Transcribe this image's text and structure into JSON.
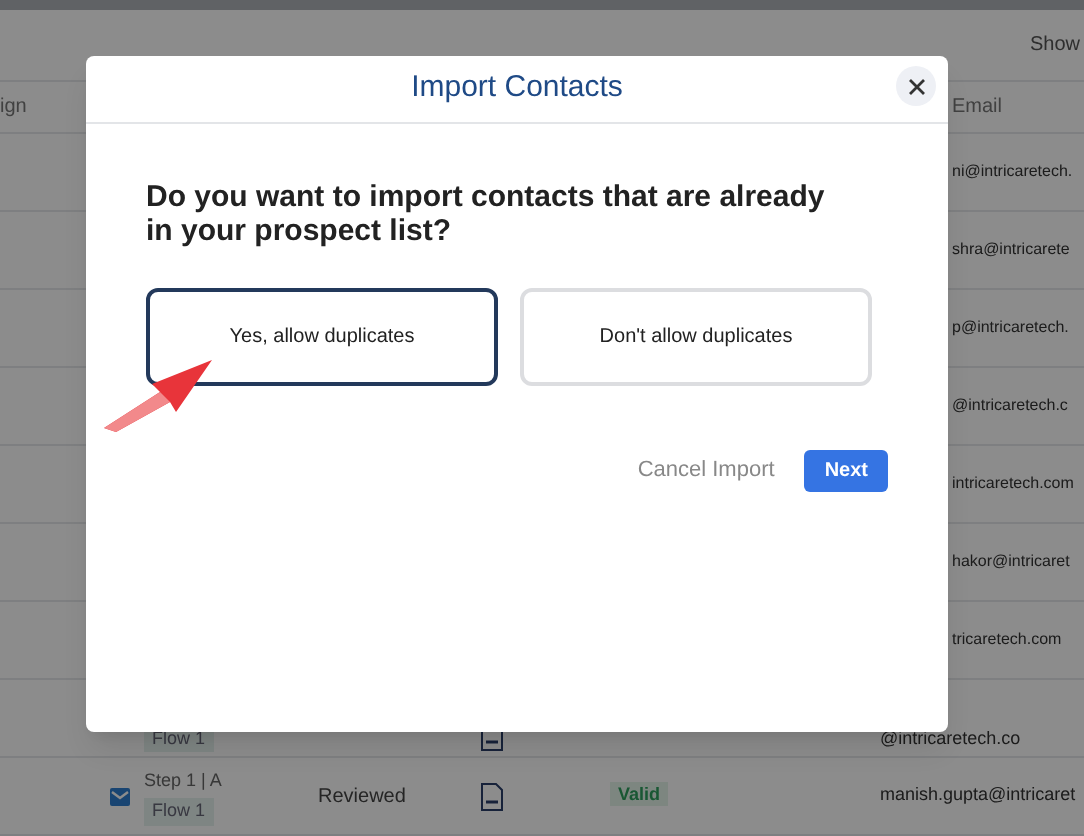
{
  "background": {
    "toolbar": {
      "show_label": "Show"
    },
    "columns": [
      "ign",
      "Email"
    ],
    "rows": [
      {
        "email": "ni@intricaretech."
      },
      {
        "email": "shra@intricarete"
      },
      {
        "email": "p@intricaretech."
      },
      {
        "email": "@intricaretech.c"
      },
      {
        "email": "intricaretech.com"
      },
      {
        "email": "hakor@intricaret"
      },
      {
        "email": "tricaretech.com"
      },
      {
        "flow": "Flow 1",
        "email": "@intricaretech.co"
      },
      {
        "step": "Step 1 | A",
        "flow": "Flow 1",
        "status": "Reviewed",
        "validity": "Valid",
        "email": "manish.gupta@intricaret"
      }
    ]
  },
  "modal": {
    "title": "Import Contacts",
    "question": "Do you want to import contacts that are already in your prospect list?",
    "options": [
      {
        "label": "Yes, allow duplicates",
        "selected": true
      },
      {
        "label": "Don't allow duplicates",
        "selected": false
      }
    ],
    "buttons": [
      {
        "label": "Cancel Import",
        "kind": "text"
      },
      {
        "label": "Next",
        "kind": "primary"
      }
    ]
  }
}
